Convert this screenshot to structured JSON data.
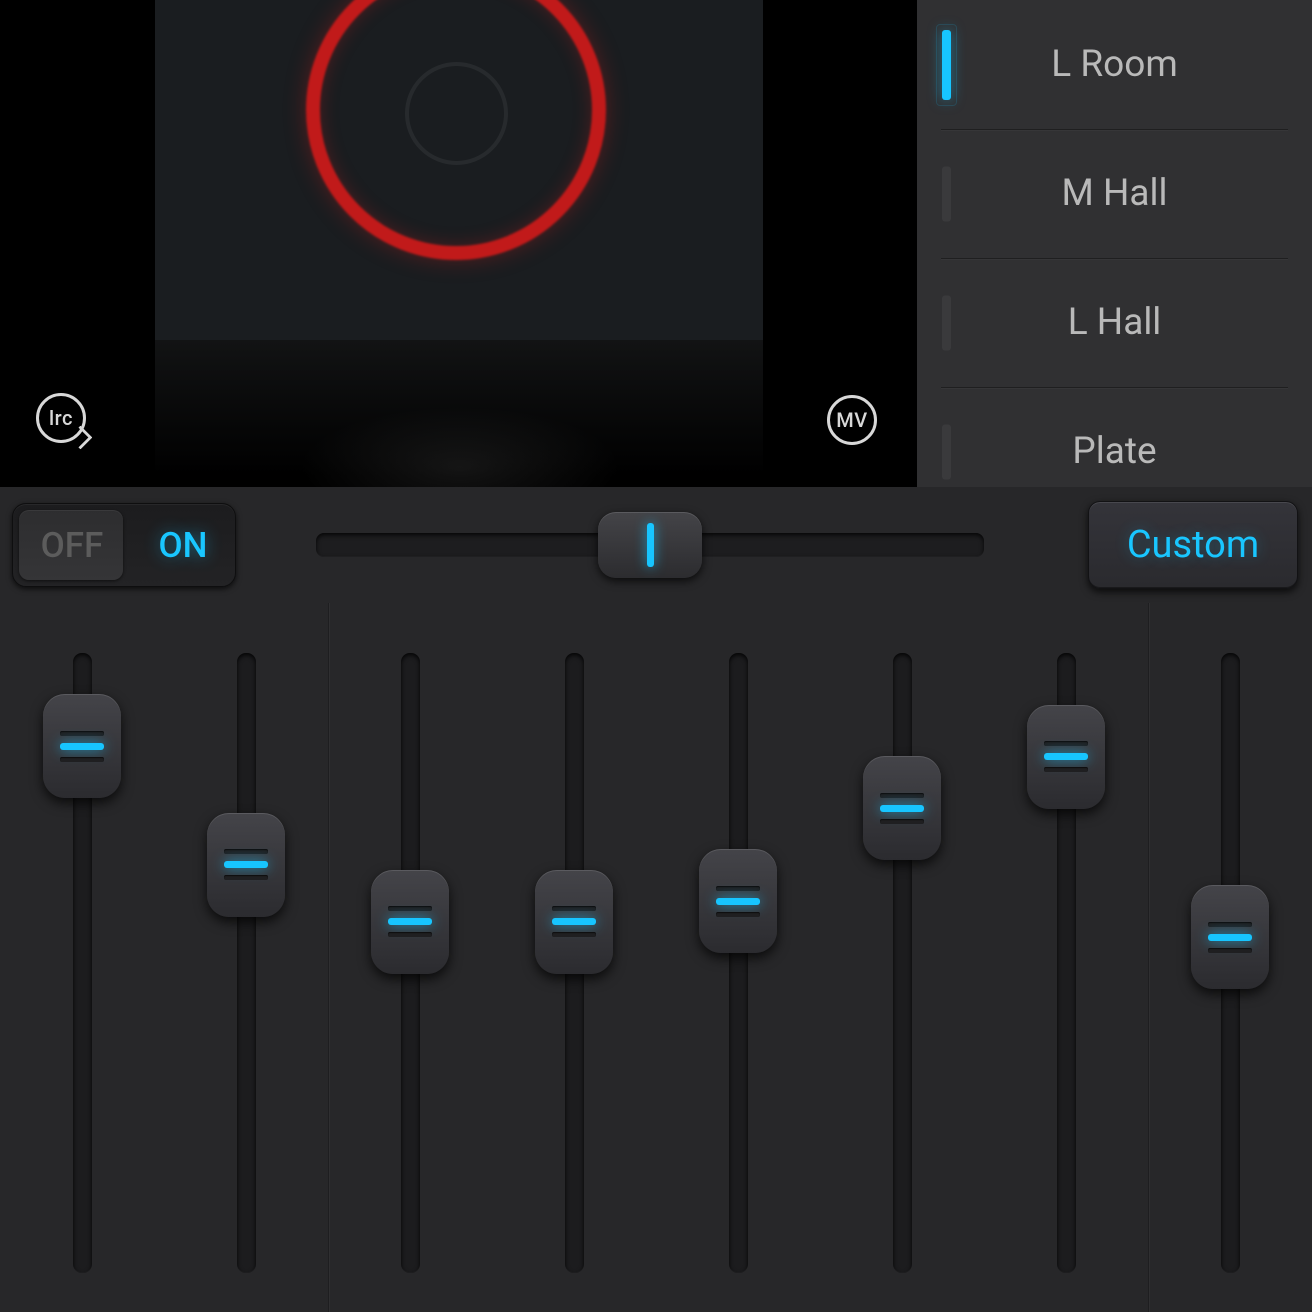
{
  "album": {
    "lrc_badge": "lrc",
    "mv_badge": "MV"
  },
  "presets": {
    "items": [
      {
        "label": "L Room",
        "selected": true
      },
      {
        "label": "M Hall",
        "selected": false
      },
      {
        "label": "L Hall",
        "selected": false
      },
      {
        "label": "Plate",
        "selected": false
      }
    ]
  },
  "controls": {
    "off_label": "OFF",
    "on_label": "ON",
    "state": "on",
    "balance_percent": 50,
    "custom_label": "Custom"
  },
  "eq": {
    "bands": [
      {
        "value_percent": 92
      },
      {
        "value_percent": 69
      },
      {
        "value_percent": 58
      },
      {
        "value_percent": 58
      },
      {
        "value_percent": 62
      },
      {
        "value_percent": 80
      },
      {
        "value_percent": 90
      },
      {
        "value_percent": 55
      }
    ]
  },
  "colors": {
    "accent": "#17c5ff"
  }
}
